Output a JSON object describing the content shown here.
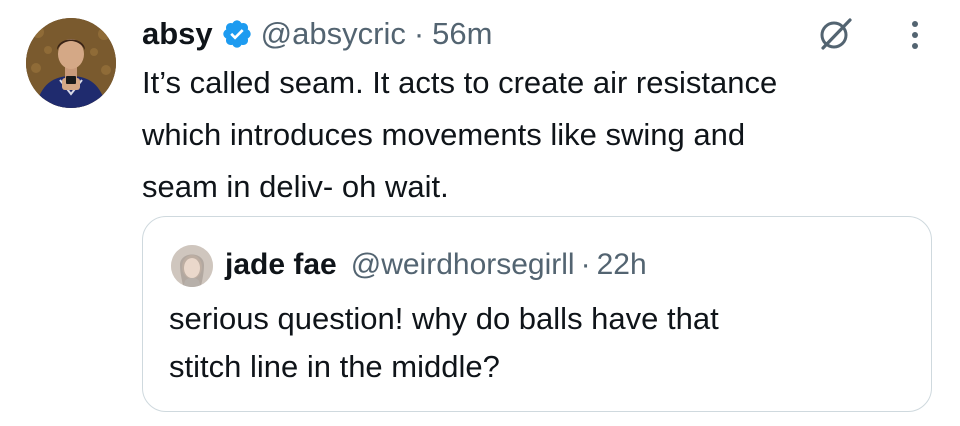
{
  "tweet": {
    "author": {
      "display_name": "absy",
      "handle": "@absycric",
      "verified": true,
      "avatar_icon": "avatar-photo"
    },
    "separator": "·",
    "time": "56m",
    "text": "It’s called seam. It acts to create air resistance\nwhich introduces movements like swing and\nseam in deliv- oh wait.",
    "actions": {
      "grok_icon": "grok-icon",
      "more_icon": "more-vertical-icon"
    }
  },
  "quoted_tweet": {
    "author": {
      "display_name": "jade fae",
      "handle": "@weirdhorsegirll",
      "avatar_icon": "avatar-photo"
    },
    "separator": "·",
    "time": "22h",
    "text": "serious question! why do balls have that\nstitch line in the middle?"
  },
  "colors": {
    "primary_text": "#0f1419",
    "secondary_text": "#536471",
    "verified_blue": "#1d9bf0",
    "border": "#cfd9de"
  }
}
